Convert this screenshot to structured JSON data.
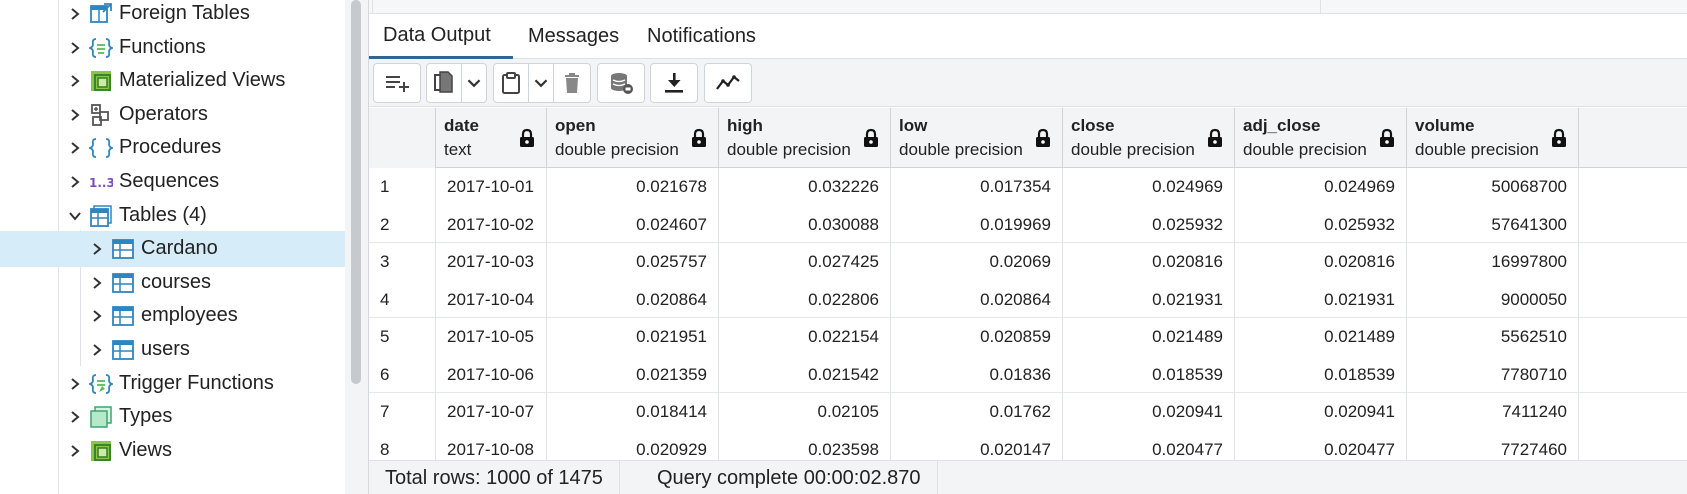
{
  "tree": {
    "items": [
      {
        "label": "Foreign Tables",
        "icon": "foreign-table-icon",
        "level": 1,
        "expanded": false,
        "selected": false
      },
      {
        "label": "Functions",
        "icon": "function-icon",
        "level": 1,
        "expanded": false,
        "selected": false
      },
      {
        "label": "Materialized Views",
        "icon": "materialized-view-icon",
        "level": 1,
        "expanded": false,
        "selected": false
      },
      {
        "label": "Operators",
        "icon": "operator-icon",
        "level": 1,
        "expanded": false,
        "selected": false
      },
      {
        "label": "Procedures",
        "icon": "procedure-icon",
        "level": 1,
        "expanded": false,
        "selected": false
      },
      {
        "label": "Sequences",
        "icon": "sequence-icon",
        "level": 1,
        "expanded": false,
        "selected": false
      },
      {
        "label": "Tables (4)",
        "icon": "tables-icon",
        "level": 1,
        "expanded": true,
        "selected": false
      },
      {
        "label": "Cardano",
        "icon": "table-icon",
        "level": 2,
        "expanded": false,
        "selected": true
      },
      {
        "label": "courses",
        "icon": "table-icon",
        "level": 2,
        "expanded": false,
        "selected": false
      },
      {
        "label": "employees",
        "icon": "table-icon",
        "level": 2,
        "expanded": false,
        "selected": false
      },
      {
        "label": "users",
        "icon": "table-icon",
        "level": 2,
        "expanded": false,
        "selected": false
      },
      {
        "label": "Trigger Functions",
        "icon": "trigger-function-icon",
        "level": 1,
        "expanded": false,
        "selected": false
      },
      {
        "label": "Types",
        "icon": "type-icon",
        "level": 1,
        "expanded": false,
        "selected": false
      },
      {
        "label": "Views",
        "icon": "view-icon",
        "level": 1,
        "expanded": false,
        "selected": false
      }
    ],
    "sequence_icon_text": "1..3"
  },
  "tabs": [
    {
      "label": "Data Output",
      "active": true
    },
    {
      "label": "Messages",
      "active": false
    },
    {
      "label": "Notifications",
      "active": false
    }
  ],
  "toolbar": {
    "buttons": [
      "add-row-icon",
      "copy-icon",
      "copy-dropdown-icon",
      "paste-icon",
      "paste-dropdown-icon",
      "delete-icon",
      "save-data-icon",
      "download-icon",
      "graph-visualiser-icon"
    ]
  },
  "grid": {
    "columns": [
      {
        "name": "date",
        "type": "text"
      },
      {
        "name": "open",
        "type": "double precision"
      },
      {
        "name": "high",
        "type": "double precision"
      },
      {
        "name": "low",
        "type": "double precision"
      },
      {
        "name": "close",
        "type": "double precision"
      },
      {
        "name": "adj_close",
        "type": "double precision"
      },
      {
        "name": "volume",
        "type": "double precision"
      }
    ],
    "rows": [
      {
        "n": "1",
        "cells": [
          "2017-10-01",
          "0.021678",
          "0.032226",
          "0.017354",
          "0.024969",
          "0.024969",
          "50068700"
        ]
      },
      {
        "n": "2",
        "cells": [
          "2017-10-02",
          "0.024607",
          "0.030088",
          "0.019969",
          "0.025932",
          "0.025932",
          "57641300"
        ]
      },
      {
        "n": "3",
        "cells": [
          "2017-10-03",
          "0.025757",
          "0.027425",
          "0.02069",
          "0.020816",
          "0.020816",
          "16997800"
        ]
      },
      {
        "n": "4",
        "cells": [
          "2017-10-04",
          "0.020864",
          "0.022806",
          "0.020864",
          "0.021931",
          "0.021931",
          "9000050"
        ]
      },
      {
        "n": "5",
        "cells": [
          "2017-10-05",
          "0.021951",
          "0.022154",
          "0.020859",
          "0.021489",
          "0.021489",
          "5562510"
        ]
      },
      {
        "n": "6",
        "cells": [
          "2017-10-06",
          "0.021359",
          "0.021542",
          "0.01836",
          "0.018539",
          "0.018539",
          "7780710"
        ]
      },
      {
        "n": "7",
        "cells": [
          "2017-10-07",
          "0.018414",
          "0.02105",
          "0.01762",
          "0.020941",
          "0.020941",
          "7411240"
        ]
      },
      {
        "n": "8",
        "cells": [
          "2017-10-08",
          "0.020929",
          "0.023598",
          "0.020147",
          "0.020477",
          "0.020477",
          "7727460"
        ]
      }
    ]
  },
  "status": {
    "total_rows": "Total rows: 1000 of 1475",
    "query_status": "Query complete 00:00:02.870"
  },
  "colors": {
    "accent": "#326690",
    "selection": "#d6ecf9",
    "icon_blue": "#2e86c1",
    "icon_green": "#5cb85c",
    "icon_purple": "#7a4fbd"
  }
}
